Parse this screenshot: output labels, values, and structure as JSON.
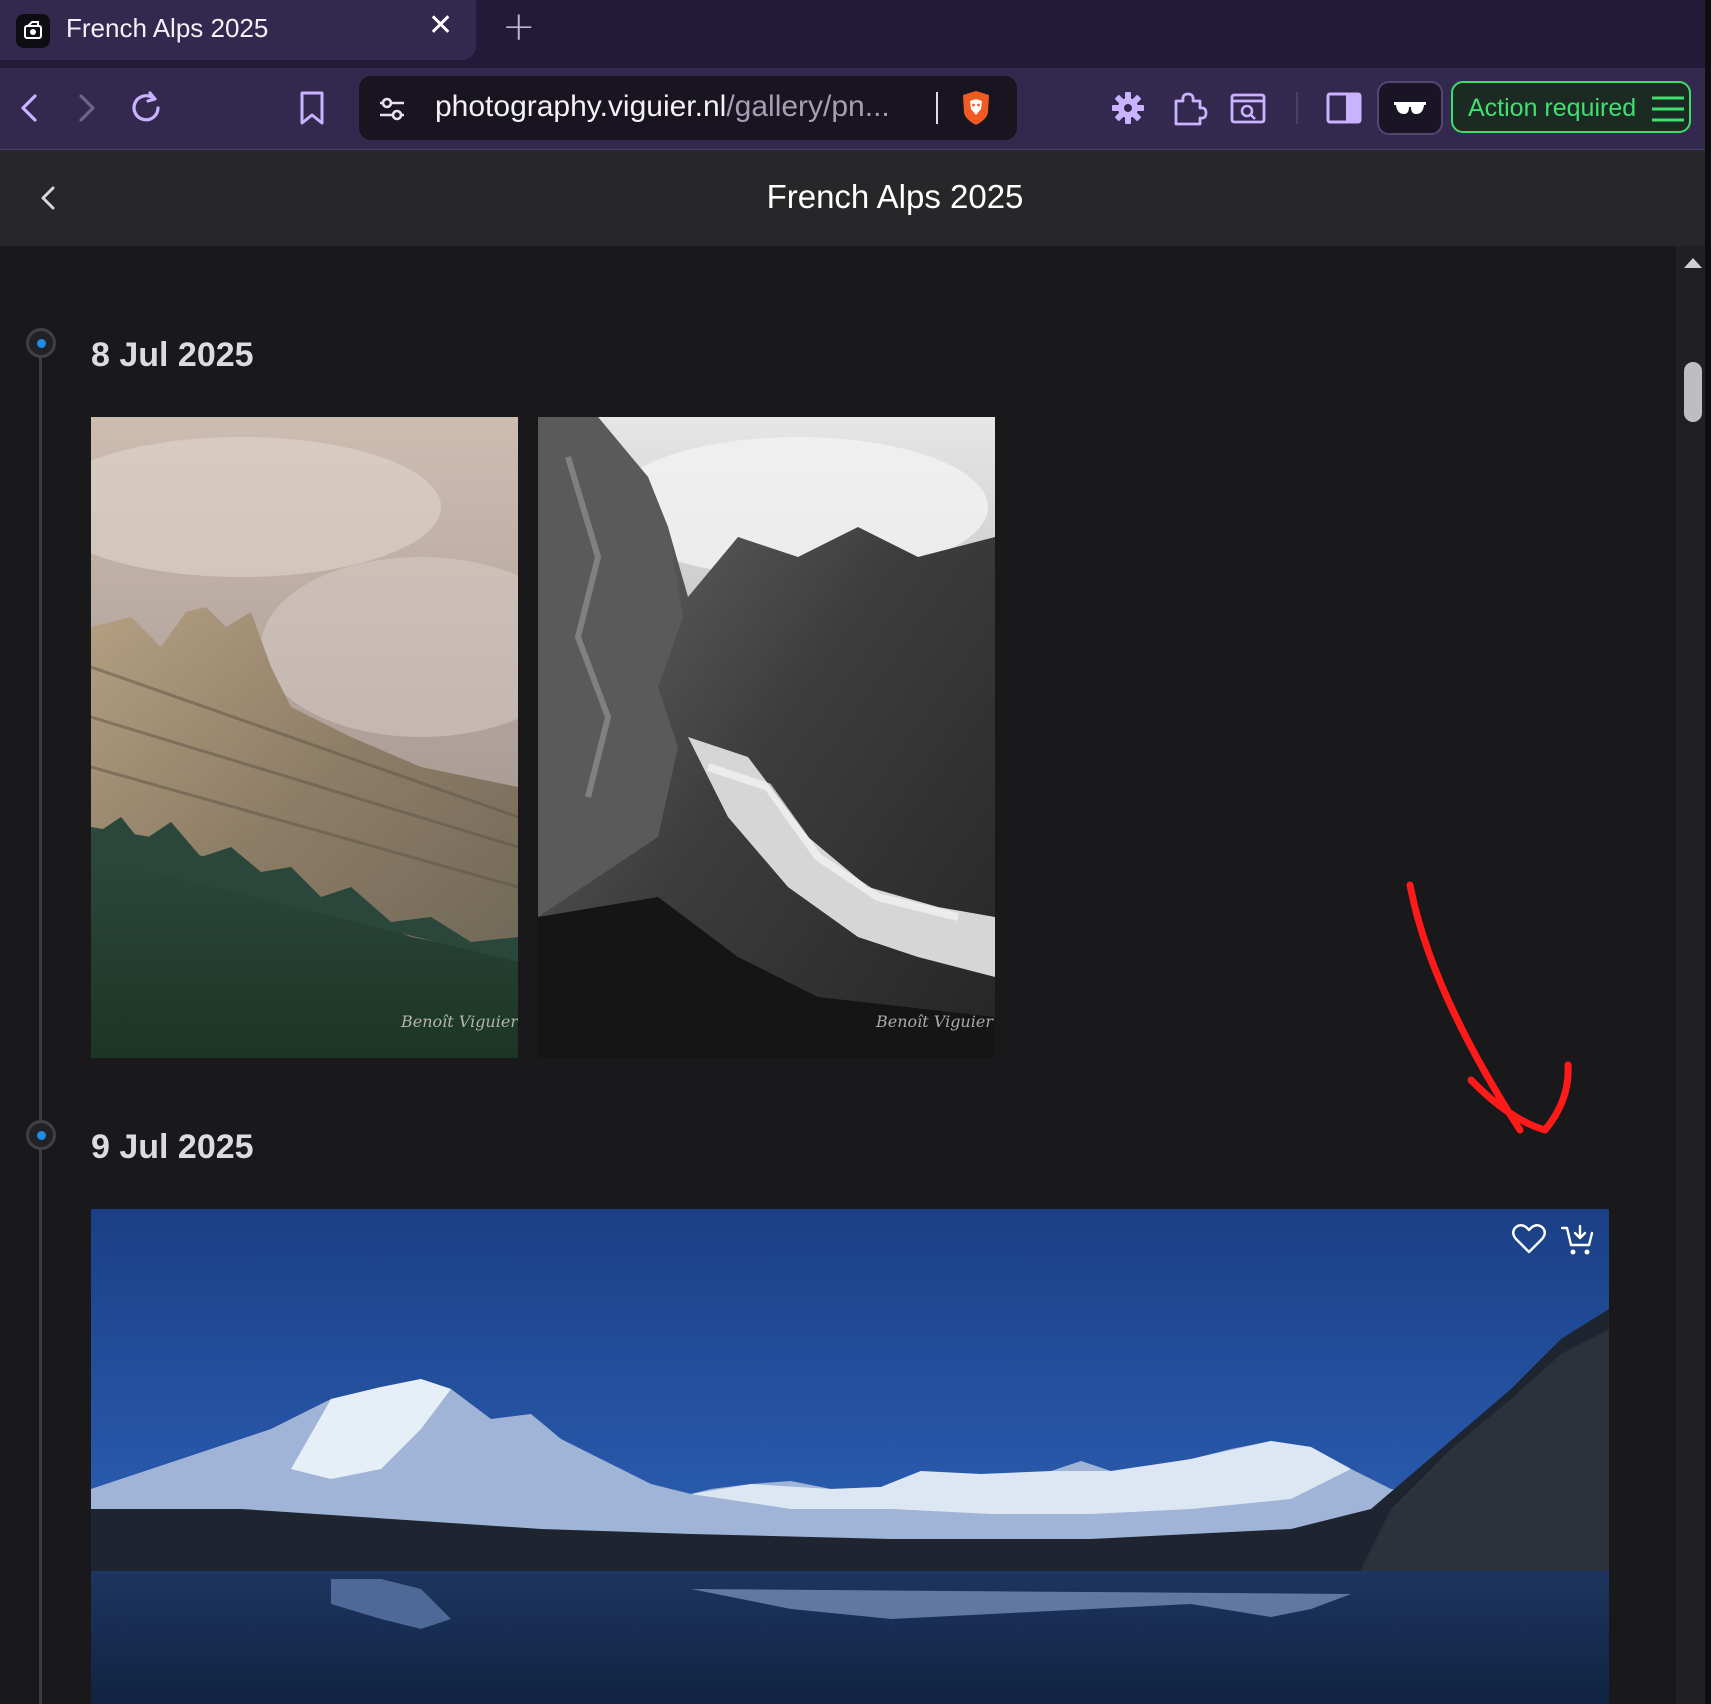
{
  "browser": {
    "tab": {
      "title": "French Alps 2025",
      "close_glyph": "✕"
    },
    "new_tab_glyph": "+",
    "address": {
      "host": "photography.viguier.nl",
      "path": "/gallery/pn..."
    },
    "action_button": {
      "label": "Action required",
      "color": "#40e070"
    },
    "accent": "#33284d"
  },
  "page": {
    "title": "French Alps 2025"
  },
  "gallery": {
    "sections": [
      {
        "date": "8 Jul 2025",
        "photos": [
          "cliff-color",
          "cliff-bw"
        ]
      },
      {
        "date": "9 Jul 2025",
        "photos": [
          "lake-panorama"
        ]
      }
    ],
    "photo_actions": [
      "heart-icon",
      "add-to-cart-icon"
    ],
    "timeline_dot_color": "#1d8ce8"
  }
}
